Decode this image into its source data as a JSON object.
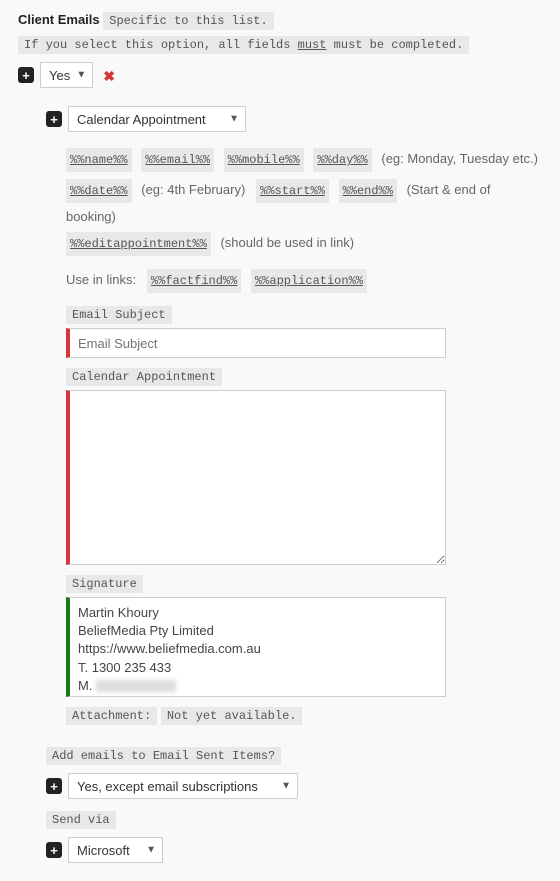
{
  "header": {
    "title": "Client Emails",
    "subtitle": "Specific to this list.",
    "warn_prefix": "If you select this option, all fields ",
    "warn_must": "must",
    "warn_suffix": " must be completed."
  },
  "enable": {
    "value": "Yes"
  },
  "type_select": {
    "value": "Calendar Appointment"
  },
  "tags": {
    "row1": [
      "%%name%%",
      "%%email%%",
      "%%mobile%%",
      "%%day%%"
    ],
    "row1_hint": "(eg: Monday, Tuesday etc.)",
    "row2a": [
      "%%date%%"
    ],
    "row2a_hint": "(eg: 4th February)",
    "row2b": [
      "%%start%%",
      "%%end%%"
    ],
    "row2b_hint": "(Start & end of booking)",
    "row3": [
      "%%editappointment%%"
    ],
    "row3_hint": "(should be used in link)",
    "links_label": "Use in links:",
    "links": [
      "%%factfind%%",
      "%%application%%"
    ]
  },
  "subject": {
    "label": "Email Subject",
    "placeholder": "Email Subject"
  },
  "body": {
    "label": "Calendar Appointment"
  },
  "signature": {
    "label": "Signature",
    "value": "Martin Khoury\nBeliefMedia Pty Limited\nhttps://www.beliefmedia.com.au\nT. 1300 235 433\nM. "
  },
  "attachment": {
    "label": "Attachment:",
    "status": "Not yet available."
  },
  "sent_items": {
    "label": "Add emails to Email Sent Items?",
    "value": "Yes, except email subscriptions"
  },
  "send_via": {
    "label": "Send via",
    "value": "Microsoft"
  }
}
